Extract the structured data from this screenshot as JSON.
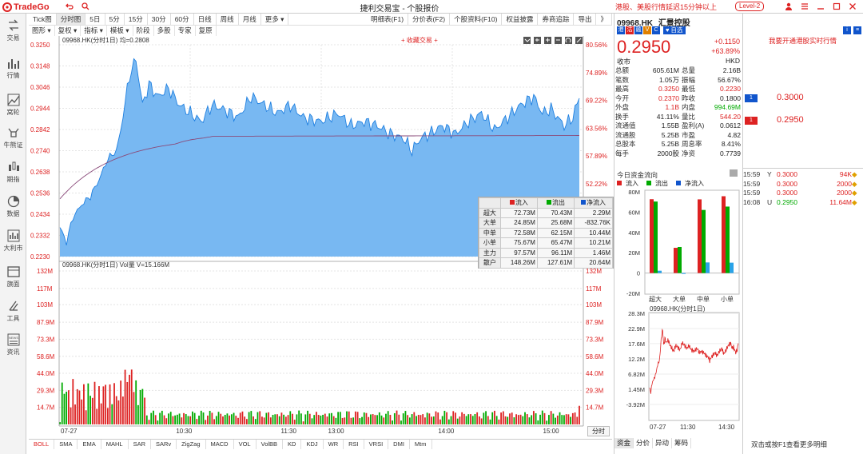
{
  "app": {
    "logo": "TradeGo",
    "title": "捷利交易宝 - 个股报价",
    "notice": "港股、美股行情延迟15分钟以上",
    "level": "Level-2"
  },
  "nav": [
    {
      "label": "交易",
      "icon": "trade-icon"
    },
    {
      "label": "行情",
      "icon": "quote-icon"
    },
    {
      "label": "窝轮",
      "icon": "warrant-icon"
    },
    {
      "label": "牛熊证",
      "icon": "bull-bear-icon"
    },
    {
      "label": "期指",
      "icon": "futures-icon"
    },
    {
      "label": "数据",
      "icon": "data-icon"
    },
    {
      "label": "大利市",
      "icon": "dalishi-icon"
    },
    {
      "label": "旗面",
      "icon": "panel-icon"
    },
    {
      "label": "工具",
      "icon": "tools-icon"
    },
    {
      "label": "资讯",
      "icon": "news-icon"
    }
  ],
  "period_tabs": [
    "Tick图",
    "分时图",
    "5日",
    "5分",
    "15分",
    "30分",
    "60分",
    "日线",
    "周线",
    "月线",
    "更多 ▾"
  ],
  "right_tabs": [
    "明细表(F1)",
    "分价表(F2)",
    "个股资料(F10)",
    "权益披露",
    "券商追踪",
    "导出",
    "》"
  ],
  "sub_tabs": [
    "图形 ▾",
    "复权 ▾",
    "指标 ▾",
    "模板 ▾",
    "阶段",
    "多股",
    "专家",
    "复原"
  ],
  "price_chart": {
    "header": "09968.HK(分时1日) 均=0.2808",
    "add_label": "+ 收藏交易 +",
    "y_ticks": [
      "0.3250",
      "0.3148",
      "0.3046",
      "0.2944",
      "0.2842",
      "0.2740",
      "0.2638",
      "0.2536",
      "0.2434",
      "0.2332",
      "0.2230"
    ],
    "pct_ticks": [
      "80.56%",
      "74.89%",
      "69.22%",
      "63.56%",
      "57.89%",
      "52.22%",
      "46.56%",
      "40.89%"
    ]
  },
  "vol_chart": {
    "header": "09968.HK(分时1日) Vol量 V=15.166M",
    "y_ticks": [
      "132M",
      "117M",
      "103M",
      "87.9M",
      "73.3M",
      "58.6M",
      "44.0M",
      "29.3M",
      "14.7M"
    ],
    "x_ticks": [
      "07-27",
      "10:30",
      "11:30",
      "13:00",
      "14:00",
      "15:00"
    ],
    "fenshi": "分时"
  },
  "indicators": [
    "BOLL",
    "SMA",
    "EMA",
    "MAHL",
    "SAR",
    "SARv",
    "ZigZag",
    "MACD",
    "VOL",
    "VolBB",
    "KD",
    "KDJ",
    "WR",
    "RSI",
    "VRSI",
    "DMI",
    "Mtm"
  ],
  "flow_table": {
    "headers": [
      "流入",
      "流出",
      "净流入"
    ],
    "rows": [
      {
        "label": "超大",
        "in": "72.73M",
        "out": "70.43M",
        "net": "2.29M"
      },
      {
        "label": "大单",
        "in": "24.85M",
        "out": "25.68M",
        "net": "-832.76K"
      },
      {
        "label": "中单",
        "in": "72.58M",
        "out": "62.15M",
        "net": "10.44M"
      },
      {
        "label": "小单",
        "in": "75.67M",
        "out": "65.47M",
        "net": "10.21M"
      },
      {
        "label": "主力",
        "in": "97.57M",
        "out": "96.11M",
        "net": "1.46M"
      },
      {
        "label": "散户",
        "in": "148.26M",
        "out": "127.61M",
        "net": "20.64M"
      }
    ]
  },
  "stock": {
    "code": "09968.HK",
    "name": "汇景控股",
    "badges": [
      "港",
      "沽",
      "融",
      "V",
      "C"
    ],
    "watch": "自选",
    "price": "0.2950",
    "change": "+0.1150",
    "change_pct": "+63.89%",
    "status": "收市",
    "currency": "HKD"
  },
  "quote": [
    {
      "k": "总额",
      "v": "605.61M",
      "vc": "",
      "k2": "总量",
      "v2": "2.16B",
      "v2c": ""
    },
    {
      "k": "笔数",
      "v": "1.05万",
      "vc": "",
      "k2": "振幅",
      "v2": "56.67%",
      "v2c": ""
    },
    {
      "k": "最高",
      "v": "0.3250",
      "vc": "red",
      "k2": "最低",
      "v2": "0.2230",
      "v2c": "red"
    },
    {
      "k": "今开",
      "v": "0.2370",
      "vc": "red",
      "k2": "昨收",
      "v2": "0.1800",
      "v2c": ""
    },
    {
      "k": "外盘",
      "v": "1.1B",
      "vc": "red",
      "k2": "内盘",
      "v2": "994.69M",
      "v2c": "green"
    },
    {
      "k": "换手",
      "v": "41.11%",
      "vc": "",
      "k2": "量比",
      "v2": "544.20",
      "v2c": "red"
    },
    {
      "k": "流通值",
      "v": "1.55B",
      "vc": "",
      "k2": "盈利(A)",
      "v2": "0.0612",
      "v2c": ""
    },
    {
      "k": "流通股",
      "v": "5.25B",
      "vc": "",
      "k2": "市盈",
      "v2": "4.82",
      "v2c": ""
    },
    {
      "k": "总股本",
      "v": "5.25B",
      "vc": "",
      "k2": "周息率",
      "v2": "8.41%",
      "v2c": ""
    },
    {
      "k": "每手",
      "v": "2000股",
      "vc": "",
      "k2": "净资",
      "v2": "0.7739",
      "v2c": ""
    }
  ],
  "fund_flow": {
    "title": "今日资金流向",
    "legend": [
      "流入",
      "流出",
      "净流入"
    ],
    "y_ticks": [
      "80M",
      "60M",
      "40M",
      "20M",
      "0",
      "-20M"
    ],
    "categories": [
      "超大",
      "大单",
      "中单",
      "小单"
    ]
  },
  "mini_chart": {
    "header": "09968.HK(分时1日)",
    "y_ticks": [
      "28.3M",
      "22.9M",
      "17.6M",
      "12.2M",
      "6.82M",
      "1.45M",
      "-3.92M"
    ],
    "x_ticks": [
      "07-27",
      "11:30",
      "14:30"
    ]
  },
  "order_book": {
    "upgrade": "我要开通港股实时行情",
    "ask": {
      "badge": "1",
      "price": "0.3000"
    },
    "bid": {
      "badge": "1",
      "price": "0.2950"
    }
  },
  "trades": [
    {
      "time": "15:59",
      "dir": "Y",
      "price": "0.3000",
      "vol": "94K",
      "flag": "◆"
    },
    {
      "time": "15:59",
      "dir": "",
      "price": "0.3000",
      "vol": "2000",
      "flag": "◆"
    },
    {
      "time": "15:59",
      "dir": "",
      "price": "0.3000",
      "vol": "2000",
      "flag": "◆"
    },
    {
      "time": "16:08",
      "dir": "U",
      "price": "0.2950",
      "vol": "11.64M",
      "flag": "◆"
    }
  ],
  "bottom_tabs": [
    "资金",
    "分价",
    "异动",
    "筹码"
  ],
  "hint": "双击或按F1查看更多明细",
  "colors": {
    "up": "#dd2222",
    "down": "#00aa00",
    "accent": "#1565c0",
    "area": "#5aa8f0"
  }
}
